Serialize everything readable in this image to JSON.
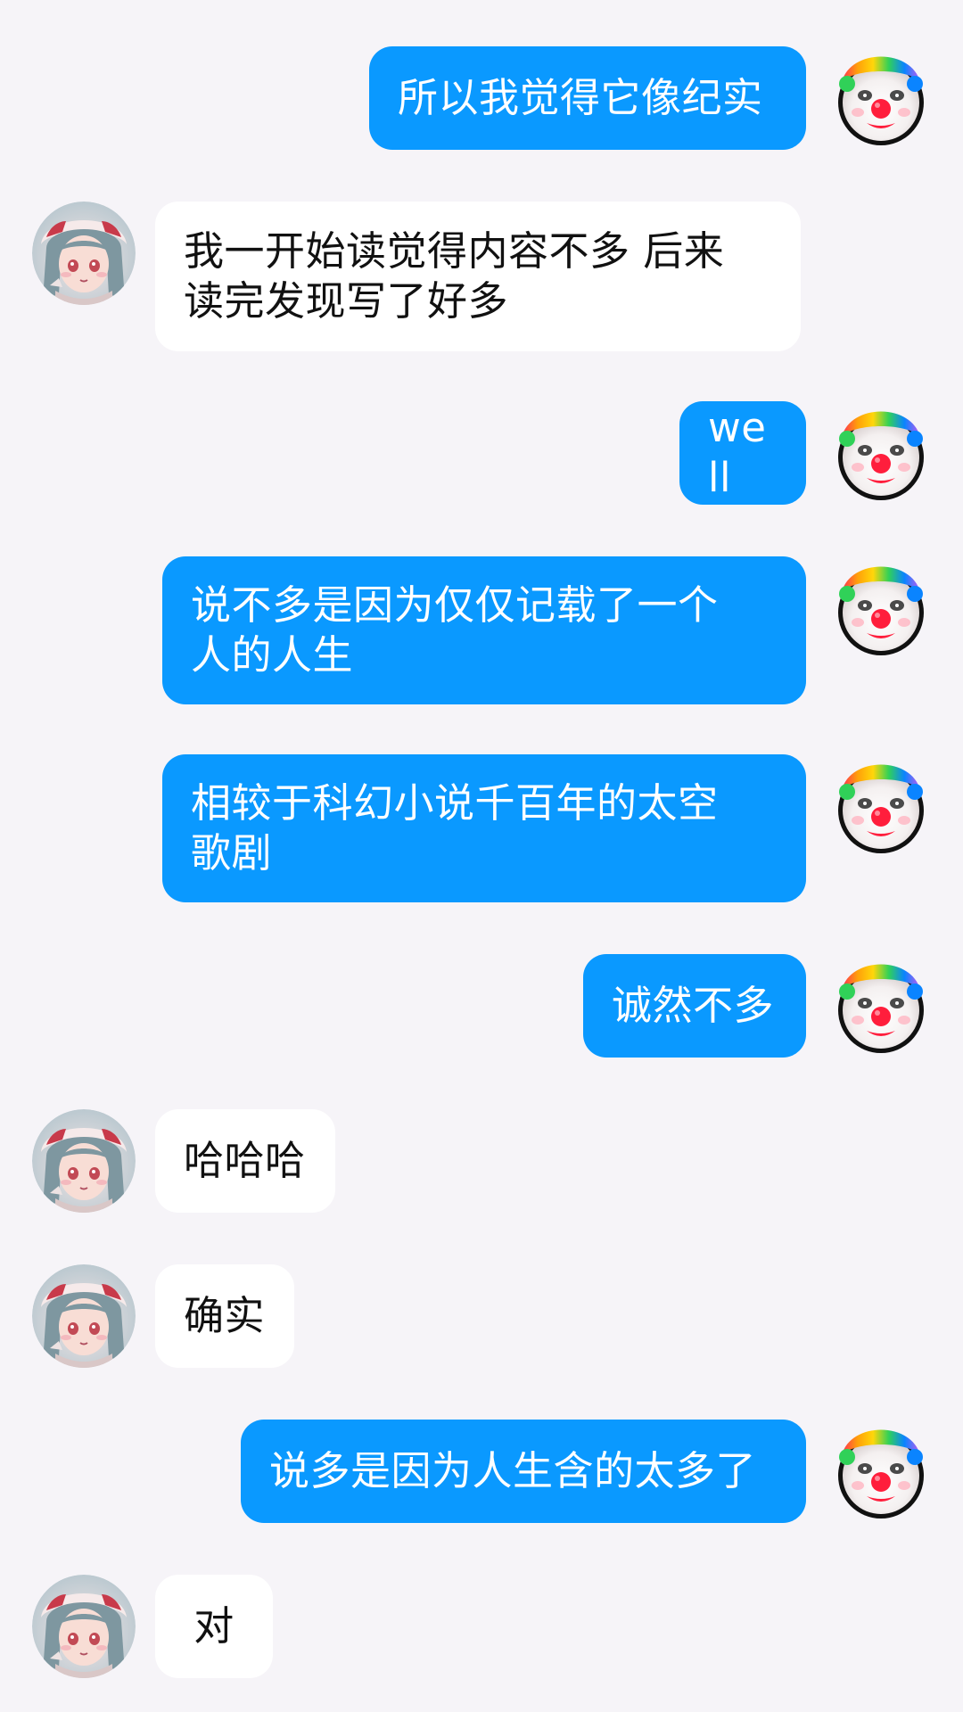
{
  "colors": {
    "background": "#F6F4F8",
    "outgoing_bubble": "#0A99FF",
    "incoming_bubble": "#FFFFFF",
    "outgoing_text": "#FFFFFF",
    "incoming_text": "#111111"
  },
  "avatars": {
    "me": "clown-avatar-icon",
    "other": "anime-girl-avatar-icon"
  },
  "messages": [
    {
      "sender": "me",
      "text": "所以我觉得它像纪实"
    },
    {
      "sender": "other",
      "text": "我一开始读觉得内容不多 后来\n读完发现写了好多"
    },
    {
      "sender": "me",
      "text": "well"
    },
    {
      "sender": "me",
      "text": "说不多是因为仅仅记载了一个\n人的人生"
    },
    {
      "sender": "me",
      "text": "相较于科幻小说千百年的太空\n歌剧"
    },
    {
      "sender": "me",
      "text": "诚然不多"
    },
    {
      "sender": "other",
      "text": "哈哈哈"
    },
    {
      "sender": "other",
      "text": "确实"
    },
    {
      "sender": "me",
      "text": "说多是因为人生含的太多了"
    },
    {
      "sender": "other",
      "text": "对"
    }
  ]
}
